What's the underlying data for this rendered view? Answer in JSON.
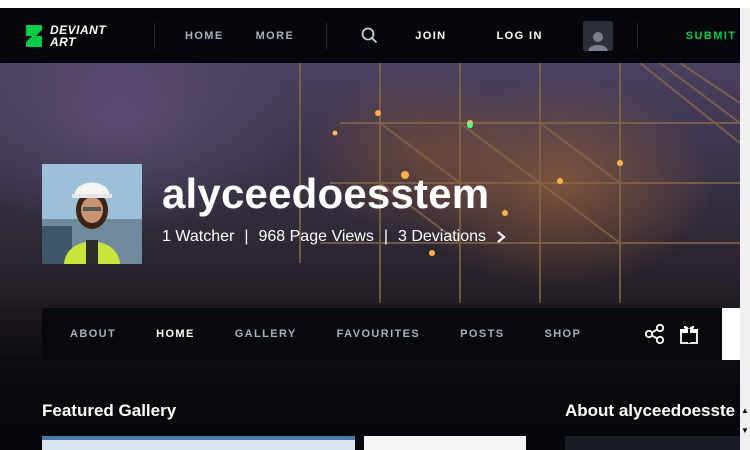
{
  "header": {
    "logo_line1": "DEVIANT",
    "logo_line2": "ART",
    "nav": {
      "home": "HOME",
      "more": "MORE",
      "join": "JOIN",
      "login": "LOG IN",
      "submit": "SUBMIT"
    },
    "icons": {
      "search": "search-icon",
      "avatar": "user-avatar-icon"
    }
  },
  "profile": {
    "username": "alyceedoesstem",
    "stats": {
      "watchers": "1 Watcher",
      "page_views": "968 Page Views",
      "deviations": "3 Deviations"
    }
  },
  "tabs": [
    "ABOUT",
    "HOME",
    "GALLERY",
    "FAVOURITES",
    "POSTS",
    "SHOP"
  ],
  "active_tab": "HOME",
  "sections": {
    "featured": "Featured Gallery",
    "about": "About alyceedoesste"
  },
  "colors": {
    "accent": "#05cc47",
    "nav_bg": "#06070d",
    "nav_text": "#aab0b8"
  }
}
